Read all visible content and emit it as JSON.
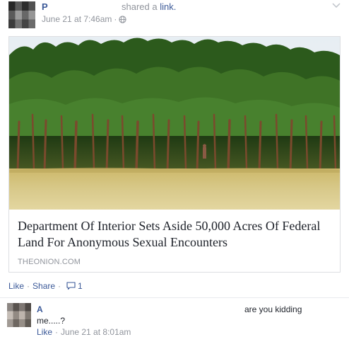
{
  "post": {
    "author": "P",
    "action_text": "shared a",
    "action_link": "link.",
    "timestamp": "June 21 at 7:46am",
    "separator": "·",
    "privacy_icon": "globe-icon",
    "menu_icon": "chevron-down-icon"
  },
  "link_card": {
    "image": "forest-photo",
    "headline": "Department Of Interior Sets Aside 50,000 Acres Of Federal Land For Anonymous Sexual Encounters",
    "domain": "THEONION.COM"
  },
  "actions": {
    "like": "Like",
    "separator": "·",
    "share": "Share",
    "comment_icon": "comment-bubble-icon",
    "comment_count": "1"
  },
  "comment": {
    "author": "A",
    "text": "me.....?",
    "side_text": "are you kidding",
    "like": "Like",
    "separator": "·",
    "time": "June 21 at 8:01am"
  },
  "colors": {
    "link_blue": "#3b5998",
    "meta_gray": "#90949c",
    "text_dark": "#1d2129",
    "border": "#dddfe2"
  }
}
